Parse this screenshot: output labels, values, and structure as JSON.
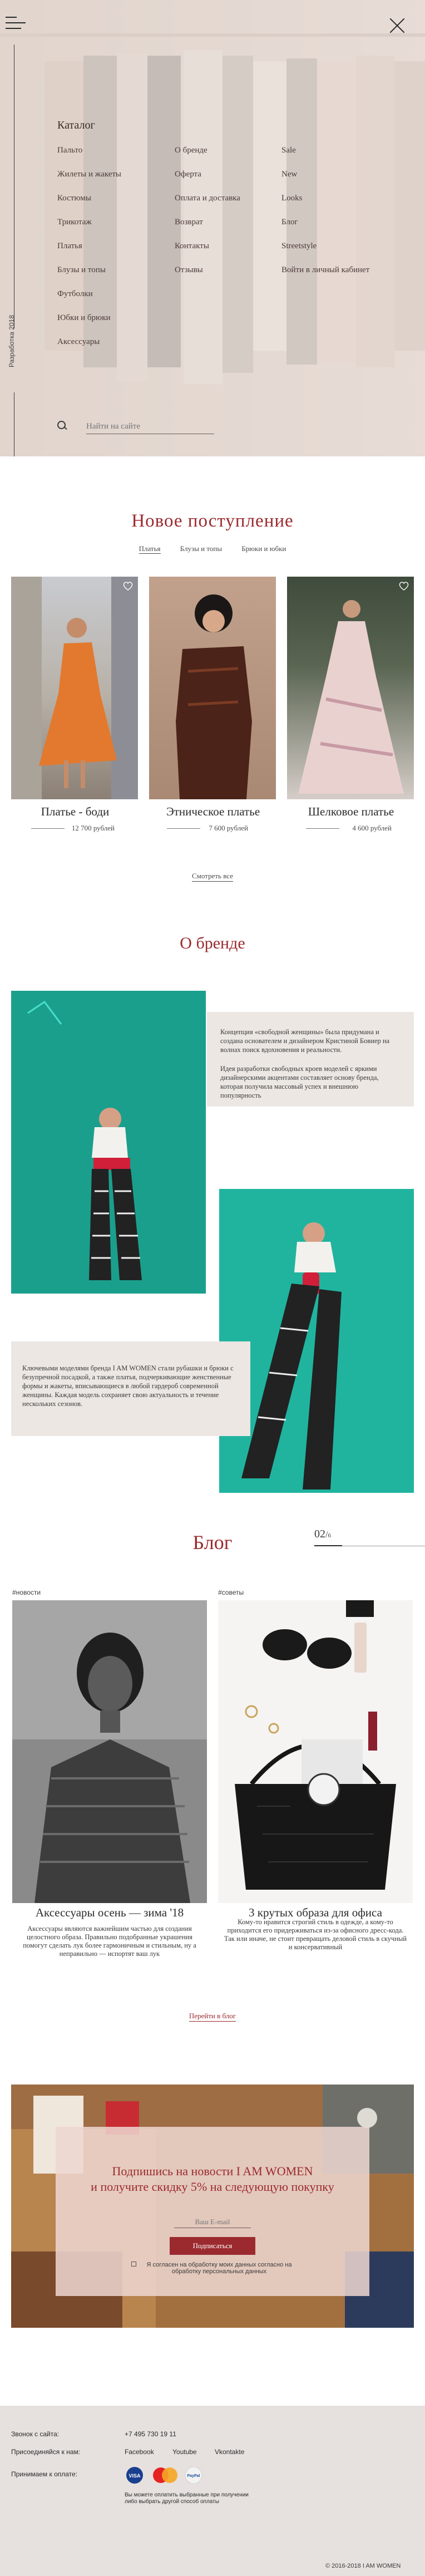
{
  "menu": {
    "heading": "Каталог",
    "catalog": [
      "Пальто",
      "Жилеты и жакеты",
      "Костюмы",
      "Трикотаж",
      "Платья",
      "Блузы и топы",
      "Футболки",
      "Юбки и брюки",
      "Аксессуары"
    ],
    "info": [
      "О бренде",
      "Оферта",
      "Оплата и доставка",
      "Возврат",
      "Контакты",
      "Отзывы"
    ],
    "extra": [
      "Sale",
      "New",
      "Looks",
      "Блог",
      "Streetstyle",
      "Войти в личный кабинет"
    ],
    "dev_label": "Разработка 2018",
    "search_placeholder": "Найти на сайте"
  },
  "new_arrivals": {
    "title": "Новое поступление",
    "tabs": [
      "Платья",
      "Блузы и топы",
      "Брюки и юбки"
    ],
    "products": [
      {
        "name": "Платье - боди",
        "price": "12 700 рублей"
      },
      {
        "name": "Этническое платье",
        "price": "7 600 рублей"
      },
      {
        "name": "Шелковое платье",
        "price": "4 600 рублей"
      }
    ],
    "see_all": "Смотреть все"
  },
  "about": {
    "title": "О бренде",
    "card1": [
      "Концепция «свободной женщины» была придумана и создана основателем и дизайнером Кристиной Бовиер на волнах поиск вдохновения и реальности.",
      "Идея разработки свободных кроев моделей с яркими дизайнерскими акцентами составляет основу бренда, которая получила массовый успех и внешнюю популярность"
    ],
    "card2": "Ключевыми моделями бренда I AM WOMEN стали рубашки и брюки с безупречной посадкой, а также платья, подчеркивающие женственные формы и жакеты, вписывающиеся в любой гардероб современной женщины. Каждая модель сохраняет свою актуальность и течение нескольких сезонов."
  },
  "blog": {
    "title": "Блог",
    "pager": {
      "current": "02",
      "total": "6"
    },
    "posts": [
      {
        "tag": "#новости",
        "title": "Аксессуары осень — зима '18",
        "text": "Аксессуары являются важнейшим частью для создания целостного образа. Правильно подобранные украшения помогут сделать лук более гармоничным и стильным, ну а неправильно — испортят ваш лук"
      },
      {
        "tag": "#советы",
        "title": "3 крутых образа для офиса",
        "text": "Кому-то нравится строгий стиль в одежде, а кому-то приходится его придерживаться из-за офисного дресс-кода. Так или иначе, не стоит превращать деловой стиль в скучный и консервативный"
      }
    ],
    "goto": "Перейти в блог"
  },
  "subscribe": {
    "title_line1": "Подпишись на новости I AM WOMEN",
    "title_line2": "и получите скидку 5% на следующую покупку",
    "email_placeholder": "Ваш E-mail",
    "button": "Подписаться",
    "consent": "Я согласен на обработку моих данных согласно на обработку персональных данных"
  },
  "footer": {
    "call_label": "Звонок с сайта:",
    "phone": "+7 495 730 19 11",
    "follow_label": "Присоединяйся к нам:",
    "socials": [
      "Facebook",
      "Youtube",
      "Vkontakte"
    ],
    "pay_label": "Принимаем к оплате:",
    "pay_icons": [
      "visa-icon",
      "mastercard-icon",
      "paypal-icon"
    ],
    "legal": "Вы можете оплатить выбранные при получении либо выбрать другой способ оплаты",
    "legal_link": "другой способ оплаты",
    "copyright": "2016-2018 I AM WOMEN"
  },
  "colors": {
    "accent": "#9b2a2e",
    "menu_bg": "#e8dcd6",
    "card_bg": "#ece7e3",
    "footer_bg": "#e6e1de",
    "about_green": "#1fae9a"
  }
}
